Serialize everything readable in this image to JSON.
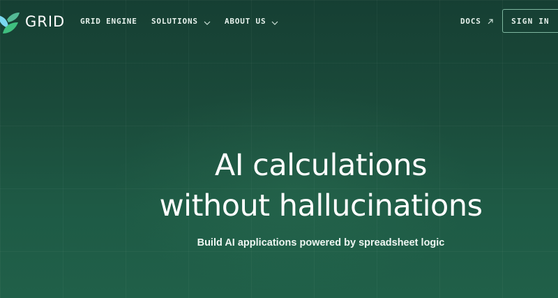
{
  "brand": {
    "name": "GRID",
    "colors": {
      "background_top": "#163f33",
      "background_bottom": "#206049",
      "logo_leaf_light": "#7ad7f0",
      "logo_leaf_green": "#3fbf7f",
      "button_border": "#7fb8a0"
    },
    "logo_icon": "leaf-icon"
  },
  "nav": {
    "items": [
      {
        "label": "GRID ENGINE",
        "has_dropdown": false
      },
      {
        "label": "SOLUTIONS",
        "has_dropdown": true,
        "icon": "chevron-down-icon"
      },
      {
        "label": "ABOUT US",
        "has_dropdown": true,
        "icon": "chevron-down-icon"
      }
    ],
    "docs": {
      "label": "DOCS",
      "icon": "arrow-up-right-icon"
    },
    "sign_in": {
      "label": "SIGN IN"
    }
  },
  "hero": {
    "title_line1": "AI calculations",
    "title_line2": "without hallucinations",
    "subtitle": "Build AI applications powered by spreadsheet logic"
  }
}
